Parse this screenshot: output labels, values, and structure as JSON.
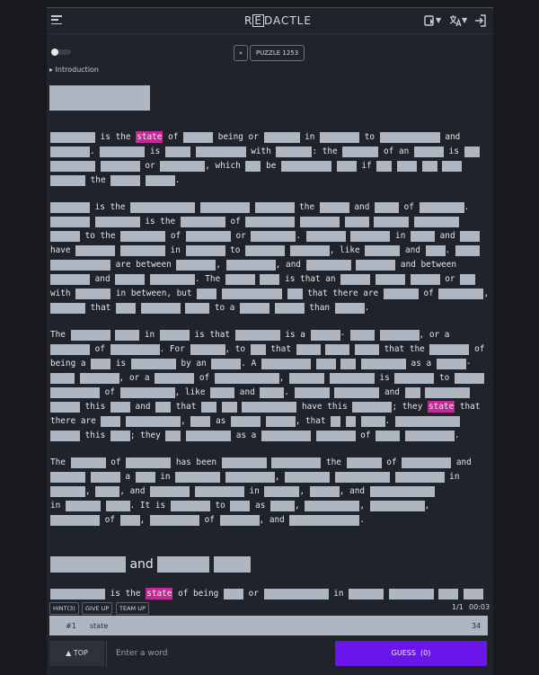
{
  "header": {
    "logo_pre": "R",
    "logo_box": "E",
    "logo_post": "DACTLE"
  },
  "puzzle": {
    "prev_label": "«",
    "label": "PUZZLE 1253"
  },
  "intro_label": "▸ Introduction",
  "article": {
    "p1": [
      [
        "is the",
        "state",
        "of",
        "being or",
        "in",
        "to",
        "and",
        "is",
        "with",
        ": the",
        "of an",
        "is",
        ", or",
        ", which",
        "be",
        "if",
        "the"
      ],
      []
    ],
    "words": {
      "is_the": "is the",
      "state": "state",
      "of": "of",
      "being_or": "being or",
      "in": "in",
      "to": "to",
      "and": "and",
      "is": "is",
      "with": "with",
      "colon_the": ": the",
      "of_an": "of an",
      "or": "or",
      "comma_which": ", which",
      "be": "be",
      "if": "if",
      "the": "the",
      "dot": "."
    },
    "heading_and": "and"
  },
  "toolbar": {
    "hint_label": "HINT(3)",
    "giveup_label": "GIVE UP",
    "teamup_label": "TEAM UP",
    "progress": "1/1",
    "timer": "00:03"
  },
  "guesses": [
    {
      "index": "#1",
      "word": "state",
      "count": "34"
    }
  ],
  "bottom": {
    "top_label": "▲ TOP",
    "input_placeholder": "Enter a word",
    "guess_label": "GUESS",
    "guess_count": "(0)"
  },
  "colors": {
    "background": "#202329",
    "redaction": "#aeb6c2",
    "highlight": "#c32a98",
    "accent": "#6a16ea"
  },
  "icons": {
    "menu": "menu-icon",
    "theme": "theme-icon",
    "language": "translate-icon",
    "login": "login-icon"
  }
}
